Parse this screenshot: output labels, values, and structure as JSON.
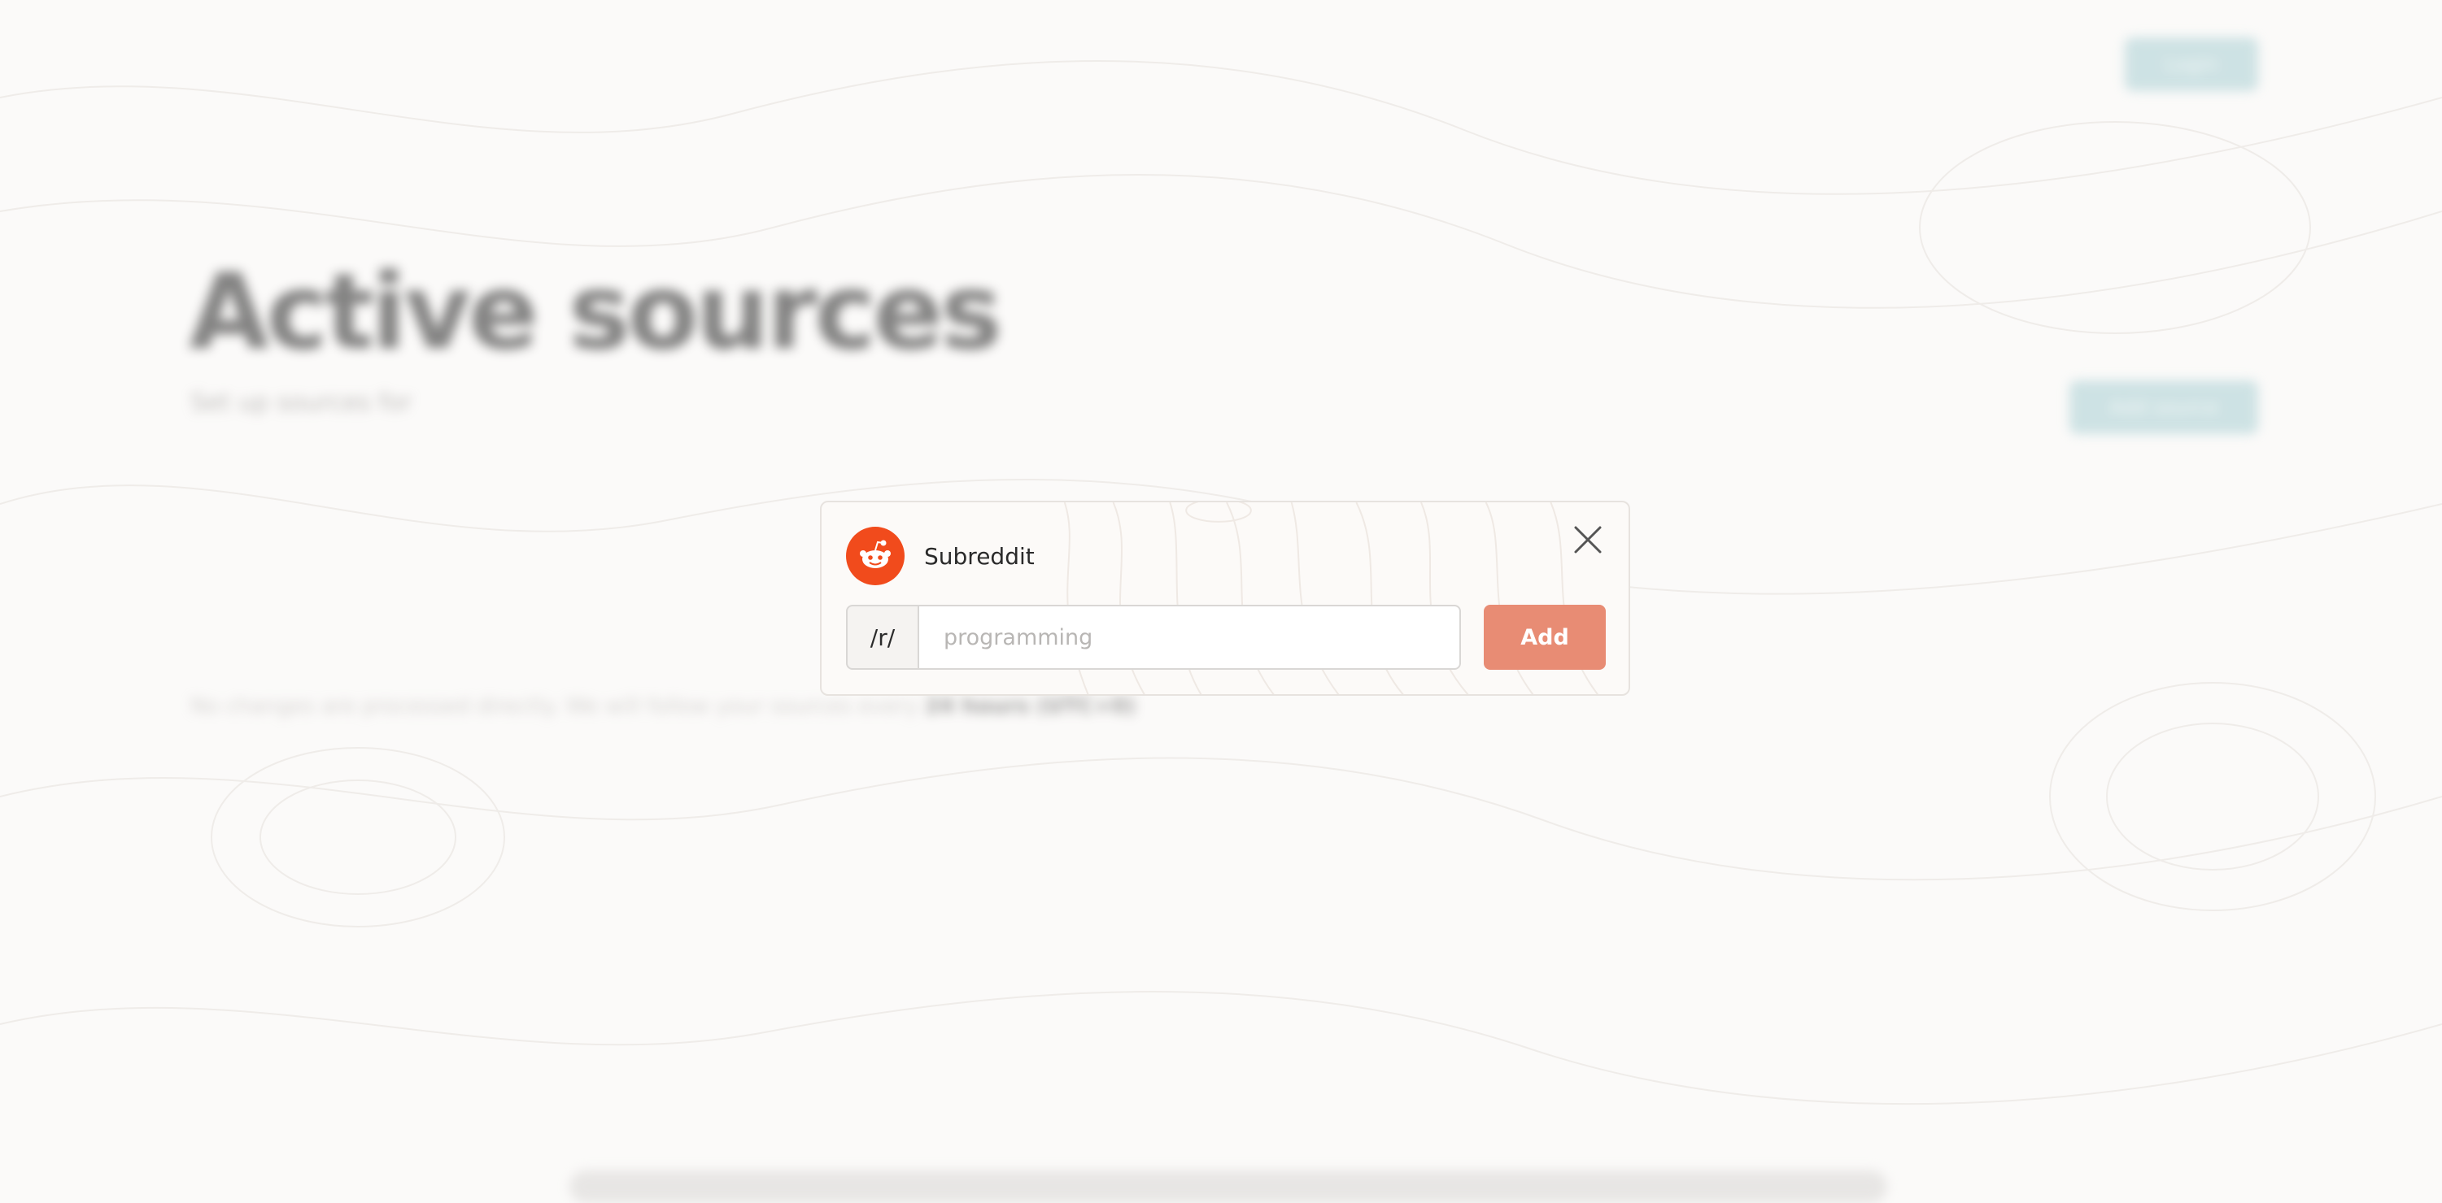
{
  "background": {
    "login_label": "Login",
    "title": "Active sources",
    "subtitle": "Set up sources for",
    "add_source_label": "Add source",
    "note_text": "No changes are processed directly. We will follow your sources every",
    "note_bold": "24 hours (UTC+0)"
  },
  "dialog": {
    "title": "Subreddit",
    "icon": "reddit-icon",
    "prefix": "/r/",
    "input_value": "",
    "input_placeholder": "programming",
    "add_label": "Add",
    "close_icon": "close-icon"
  },
  "colors": {
    "reddit": "#f14b1c",
    "add_button": "#e88c74",
    "background_button": "#a9cfd3",
    "page_background": "#fbfaf9"
  }
}
